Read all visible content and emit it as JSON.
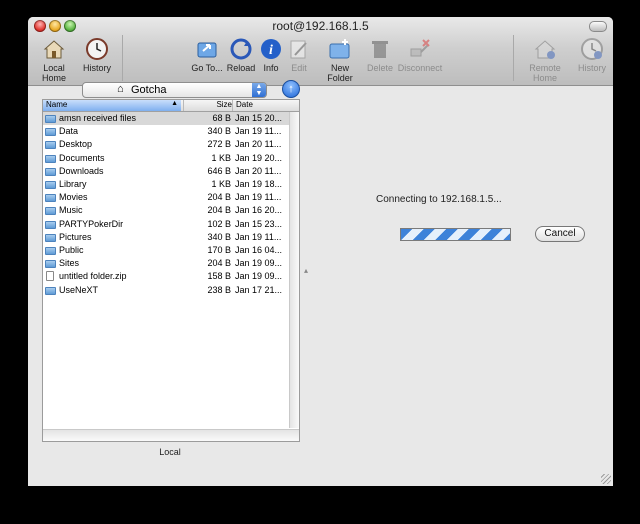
{
  "window": {
    "title": "root@192.168.1.5"
  },
  "toolbar": {
    "left": [
      {
        "label": "Local Home",
        "icon": "home-icon"
      },
      {
        "label": "History",
        "icon": "history-clock-icon"
      }
    ],
    "center": [
      {
        "label": "Go To...",
        "icon": "goto-folder-icon",
        "enabled": true
      },
      {
        "label": "Reload",
        "icon": "reload-icon",
        "enabled": true
      },
      {
        "label": "Info",
        "icon": "info-icon",
        "enabled": true
      },
      {
        "label": "Edit",
        "icon": "edit-icon",
        "enabled": false
      },
      {
        "label": "New Folder",
        "icon": "new-folder-icon",
        "enabled": true
      },
      {
        "label": "Delete",
        "icon": "trash-icon",
        "enabled": false
      },
      {
        "label": "Disconnect",
        "icon": "disconnect-icon",
        "enabled": false
      }
    ],
    "right": [
      {
        "label": "Remote Home",
        "icon": "remote-home-icon",
        "enabled": false
      },
      {
        "label": "History",
        "icon": "history-clock-icon",
        "enabled": false
      }
    ]
  },
  "local": {
    "location": "Gotcha",
    "columns": {
      "name": "Name",
      "size": "Size",
      "date": "Date"
    },
    "files": [
      {
        "name": "amsn received files",
        "size": "68 B",
        "date": "Jan 15 20...",
        "type": "folder",
        "selected": true
      },
      {
        "name": "Data",
        "size": "340 B",
        "date": "Jan 19 11...",
        "type": "folder"
      },
      {
        "name": "Desktop",
        "size": "272 B",
        "date": "Jan 20 11...",
        "type": "folder"
      },
      {
        "name": "Documents",
        "size": "1 KB",
        "date": "Jan 19 20...",
        "type": "folder"
      },
      {
        "name": "Downloads",
        "size": "646 B",
        "date": "Jan 20 11...",
        "type": "folder"
      },
      {
        "name": "Library",
        "size": "1 KB",
        "date": "Jan 19 18...",
        "type": "folder"
      },
      {
        "name": "Movies",
        "size": "204 B",
        "date": "Jan 19 11...",
        "type": "folder"
      },
      {
        "name": "Music",
        "size": "204 B",
        "date": "Jan 16 20...",
        "type": "folder"
      },
      {
        "name": "PARTYPokerDir",
        "size": "102 B",
        "date": "Jan 15 23...",
        "type": "folder"
      },
      {
        "name": "Pictures",
        "size": "340 B",
        "date": "Jan 19 11...",
        "type": "folder"
      },
      {
        "name": "Public",
        "size": "170 B",
        "date": "Jan 16 04...",
        "type": "folder"
      },
      {
        "name": "Sites",
        "size": "204 B",
        "date": "Jan 19 09...",
        "type": "folder"
      },
      {
        "name": "untitled folder.zip",
        "size": "158 B",
        "date": "Jan 19 09...",
        "type": "file"
      },
      {
        "name": "UseNeXT",
        "size": "238 B",
        "date": "Jan 17 21...",
        "type": "folder"
      }
    ],
    "label": "Local"
  },
  "remote": {
    "status": "Connecting to 192.168.1.5...",
    "cancel_label": "Cancel"
  },
  "colors": {
    "selection": "#d8d8d8",
    "accent": "#3d82d9"
  }
}
